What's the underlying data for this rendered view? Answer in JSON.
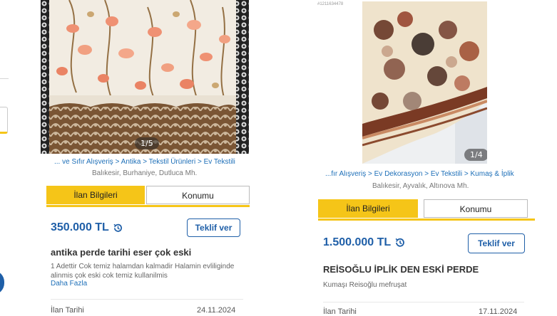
{
  "colors": {
    "accent": "#f5c518",
    "link": "#1d6fb8",
    "price": "#1f5fa8"
  },
  "listings": [
    {
      "image_counter": "1/5",
      "breadcrumb": "... ve Sıfır Alışveriş > Antika > Tekstil Ürünleri > Ev Tekstili",
      "location": "Balıkesir, Burhaniye, Dutluca Mh.",
      "tabs": [
        "İlan Bilgileri",
        "Konumu"
      ],
      "price": "350.000 TL",
      "offer_label": "Teklif ver",
      "title": "antika perde tarihi eser çok eski",
      "description": "1 Adettir Cok temiz halamdan kalmadir Halamin evliliginde alinmis çok eski cok temiz kullanilmis",
      "more_label": "Daha Fazla",
      "date_label": "İlan Tarihi",
      "date_value": "24.11.2024"
    },
    {
      "listing_id": "#1211634478",
      "image_counter": "1/4",
      "breadcrumb": "...fır Alışveriş > Ev Dekorasyon > Ev Tekstili > Kumaş & İplik",
      "location": "Balıkesir, Ayvalık, Altınova Mh.",
      "tabs": [
        "İlan Bilgileri",
        "Konumu"
      ],
      "price": "1.500.000 TL",
      "offer_label": "Teklif ver",
      "title": "REİSOĞLU İPLİK DEN ESKİ PERDE",
      "description": "Kumaşı Reisoğlu mefruşat",
      "date_label": "İlan Tarihi",
      "date_value": "17.11.2024"
    }
  ]
}
